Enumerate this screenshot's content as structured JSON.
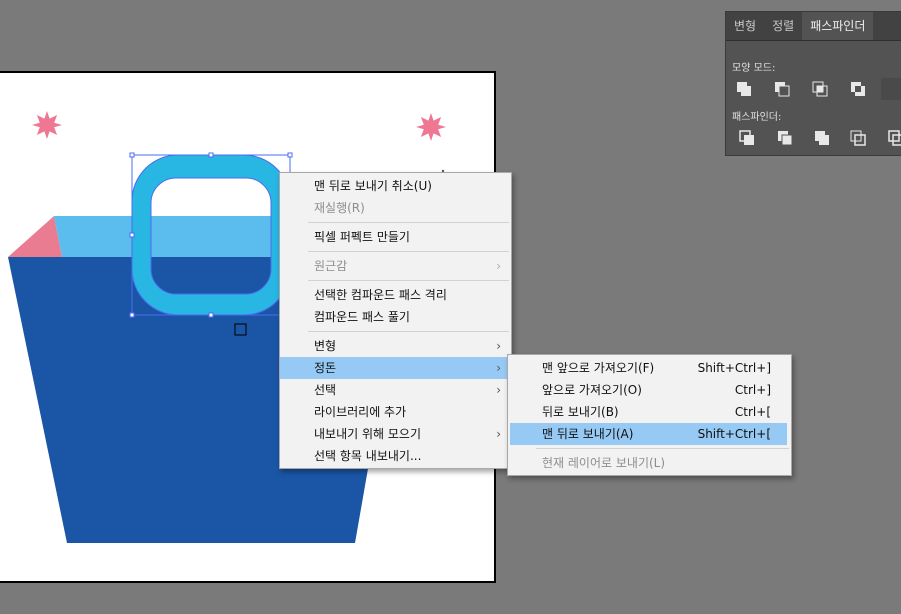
{
  "panel": {
    "tabs": [
      {
        "label": "변형"
      },
      {
        "label": "정렬"
      },
      {
        "label": "패스파인더"
      }
    ],
    "shape_modes_label": "모양 모드:",
    "pathfinders_label": "패스파인더:",
    "shape_mode_buttons": [
      "unite-icon",
      "minus-front-icon",
      "intersect-icon",
      "exclude-icon"
    ],
    "pathfinder_buttons": [
      "divide-icon",
      "trim-icon",
      "merge-icon",
      "crop-icon",
      "outline-icon"
    ]
  },
  "context_menu": {
    "items": [
      {
        "label": "맨 뒤로 보내기 취소(U)",
        "disabled": false
      },
      {
        "label": "재실행(R)",
        "disabled": true
      },
      {
        "label": "픽셀 퍼펙트 만들기",
        "disabled": false
      },
      {
        "label": "원근감",
        "disabled": true,
        "submenu": true
      },
      {
        "label": "선택한 컴파운드 패스 격리",
        "disabled": false
      },
      {
        "label": "컴파운드 패스 풀기",
        "disabled": false
      },
      {
        "label": "변형",
        "disabled": false,
        "submenu": true
      },
      {
        "label": "정돈",
        "disabled": false,
        "submenu": true,
        "highlighted": true
      },
      {
        "label": "선택",
        "disabled": false,
        "submenu": true
      },
      {
        "label": "라이브러리에 추가",
        "disabled": false
      },
      {
        "label": "내보내기 위해 모으기",
        "disabled": false,
        "submenu": true
      },
      {
        "label": "선택 항목 내보내기...",
        "disabled": false
      }
    ]
  },
  "arrange_submenu": {
    "items": [
      {
        "label": "맨 앞으로 가져오기(F)",
        "shortcut": "Shift+Ctrl+]"
      },
      {
        "label": "앞으로 가져오기(O)",
        "shortcut": "Ctrl+]"
      },
      {
        "label": "뒤로 보내기(B)",
        "shortcut": "Ctrl+["
      },
      {
        "label": "맨 뒤로 보내기(A)",
        "shortcut": "Shift+Ctrl+[",
        "highlighted": true
      },
      {
        "label": "현재 레이어로 보내기(L)",
        "shortcut": "",
        "disabled": true
      }
    ]
  },
  "colors": {
    "canvas_bg": "#7a7a7a",
    "bag_body": "#1b55a6",
    "bag_top": "#5bbcee",
    "handle": "#28b6e2",
    "flap": "#ea7c92",
    "star": "#ee7893",
    "selection": "#4a6cf2",
    "menu_highlight": "#96c9f4"
  }
}
